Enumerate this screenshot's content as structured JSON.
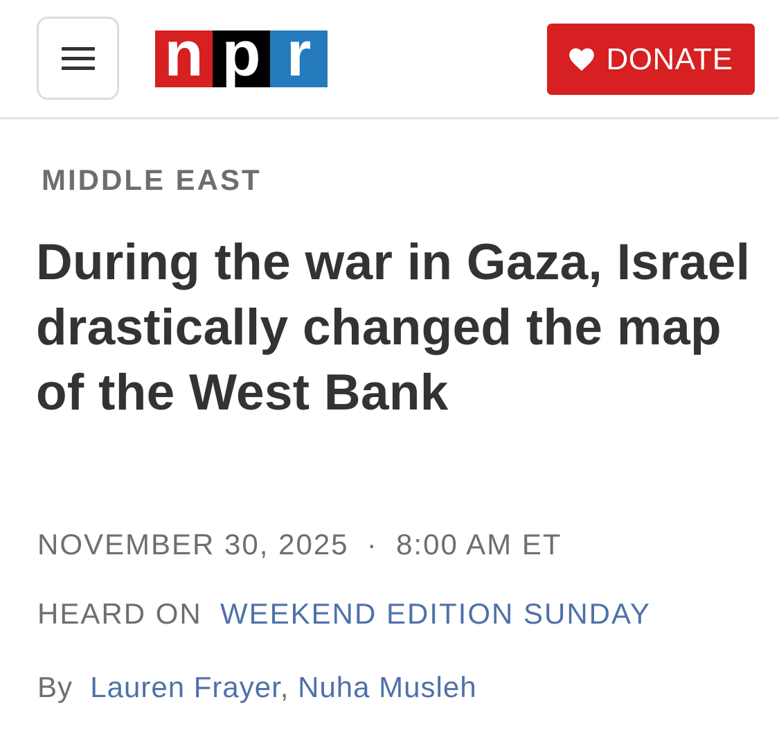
{
  "header": {
    "logo_letters": [
      "n",
      "p",
      "r"
    ],
    "donate_label": "DONATE",
    "menu_icon": "hamburger-menu-icon",
    "donate_icon": "heart-icon",
    "colors": {
      "npr_red": "#d62021",
      "npr_black": "#000000",
      "npr_blue": "#237bbd",
      "donate_bg": "#d62021"
    }
  },
  "article": {
    "section": "MIDDLE EAST",
    "headline": "During the war in Gaza, Israel drastically changed the map of the West Bank",
    "date": "NOVEMBER 30, 2025",
    "separator": "·",
    "time": "8:00 AM ET",
    "heard_on_prefix": "HEARD ON",
    "program": "WEEKEND EDITION SUNDAY",
    "by_prefix": "By",
    "authors": [
      "Lauren Frayer",
      "Nuha Musleh"
    ],
    "author_separator": ", ",
    "link_color": "#4e71a9"
  }
}
